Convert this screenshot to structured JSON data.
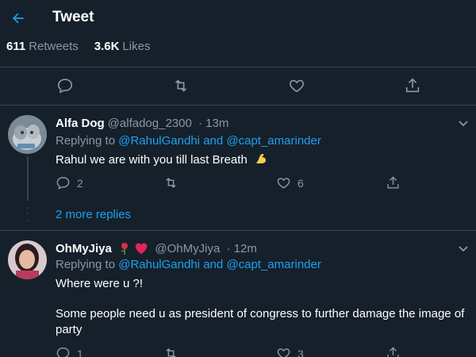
{
  "header": {
    "title": "Tweet"
  },
  "stats": {
    "retweets_count": "611",
    "retweets_label": "Retweets",
    "likes_count": "3.6K",
    "likes_label": "Likes"
  },
  "replies": [
    {
      "name": "Alfa Dog",
      "handle": "@alfadog_2300",
      "time": "· 13m",
      "replying_prefix": "Replying to",
      "mention1": "@RahulGandhi",
      "and": "and",
      "mention2": "@capt_amarinder",
      "text": "Rahul we are with you till last Breath",
      "reply_count": "2",
      "like_count": "6"
    },
    {
      "name": "OhMyJiya",
      "handle": "@OhMyJiya",
      "time": "· 12m",
      "replying_prefix": "Replying to",
      "mention1": "@RahulGandhi",
      "and": "and",
      "mention2": "@capt_amarinder",
      "text1": "Where were u ?!",
      "text2": "Some people need u as president of congress to further damage the image of party",
      "reply_count": "1",
      "like_count": "3"
    }
  ],
  "more_replies": "2 more replies",
  "colors": {
    "background": "#15202b",
    "accent": "#1da1f2",
    "muted": "#8899a6",
    "divider": "#38444d"
  }
}
